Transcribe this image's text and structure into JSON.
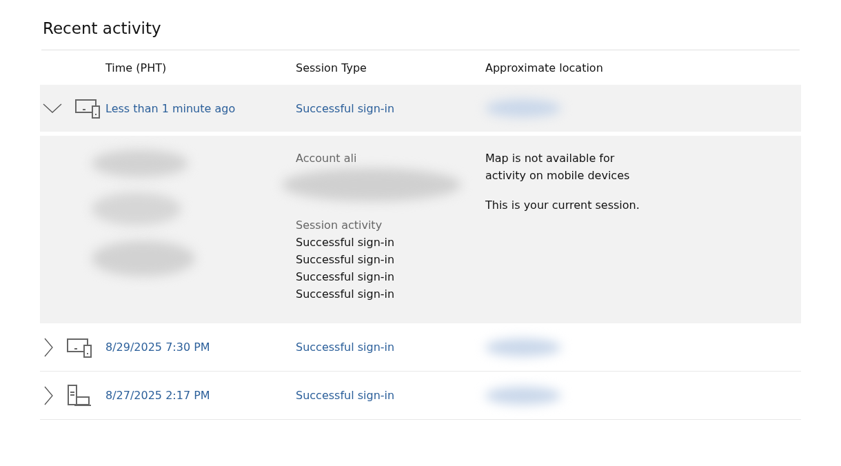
{
  "title": "Recent activity",
  "columns": [
    "Time (PHT)",
    "Session Type",
    "Approximate location"
  ],
  "rows": [
    {
      "kind": "tablet-phone",
      "time": "Less than 1 minute ago",
      "session_type": "Successful sign-in",
      "expanded": true,
      "details": {
        "account_label": "Account ali",
        "activity_label": "Session activity",
        "activity": [
          "Successful sign-in",
          "Successful sign-in",
          "Successful sign-in",
          "Successful sign-in"
        ],
        "map_note": "Map is not available for activity on mobile devices",
        "current_note": "This is your current session."
      }
    },
    {
      "kind": "tablet-phone",
      "time": "8/29/2025 7:30 PM",
      "session_type": "Successful sign-in",
      "expanded": false
    },
    {
      "kind": "desktop-laptop",
      "time": "8/27/2025 2:17 PM",
      "session_type": "Successful sign-in",
      "expanded": false
    }
  ]
}
